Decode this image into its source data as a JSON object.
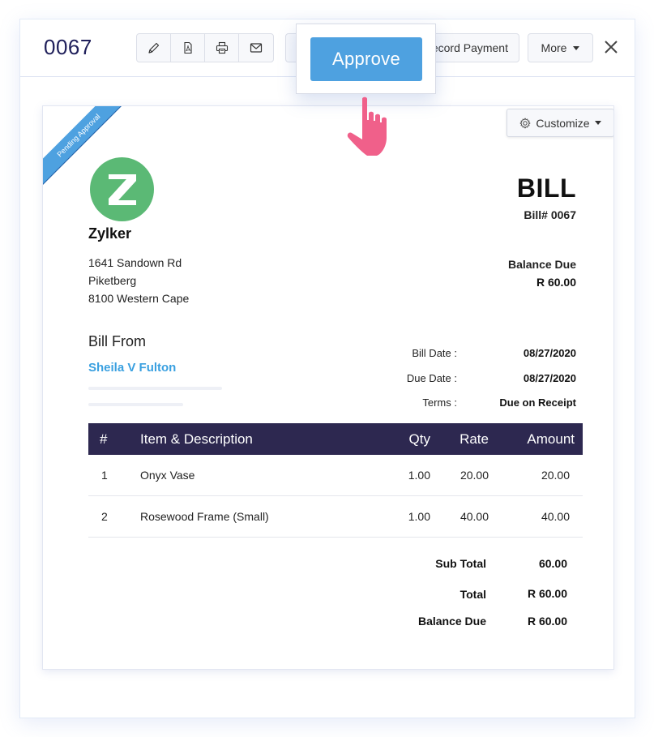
{
  "header": {
    "bill_id": "0067",
    "toolbar_icons": [
      {
        "name": "edit-icon",
        "label": "Edit"
      },
      {
        "name": "pdf-icon",
        "label": "PDF"
      },
      {
        "name": "print-icon",
        "label": "Print"
      },
      {
        "name": "mail-icon",
        "label": "Email"
      }
    ],
    "record_payment_label": "Record Payment",
    "more_label": "More",
    "close_icon": "close-icon"
  },
  "popover": {
    "approve_label": "Approve"
  },
  "document": {
    "status_ribbon": "Pending Approval",
    "customize_label": "Customize",
    "company": {
      "logo_letter": "Z",
      "name": "Zylker",
      "address": [
        "1641 Sandown Rd",
        "Piketberg",
        "8100 Western Cape"
      ]
    },
    "title": "BILL",
    "bill_number": "Bill# 0067",
    "balance_due_label": "Balance Due",
    "balance_due_value": "R 60.00",
    "bill_from_label": "Bill From",
    "vendor_name": "Sheila V Fulton",
    "meta": [
      {
        "label": "Bill Date :",
        "value": "08/27/2020"
      },
      {
        "label": "Due Date :",
        "value": "08/27/2020"
      },
      {
        "label": "Terms :",
        "value": "Due on Receipt"
      }
    ],
    "table": {
      "headers": [
        "#",
        "Item & Description",
        "Qty",
        "Rate",
        "Amount"
      ],
      "rows": [
        [
          "1",
          "Onyx Vase",
          "1.00",
          "20.00",
          "20.00"
        ],
        [
          "2",
          "Rosewood Frame (Small)",
          "1.00",
          "40.00",
          "40.00"
        ]
      ]
    },
    "totals": [
      {
        "label": "Sub Total",
        "value": "60.00"
      },
      {
        "label": "Total",
        "value": "R 60.00"
      },
      {
        "label": "Balance Due",
        "value": "R 60.00"
      }
    ]
  },
  "colors": {
    "accent": "#4ea1e0",
    "table_header": "#2d2850",
    "logo_green": "#5bb975",
    "vendor_link": "#3aa0e0",
    "pointer_hand": "#f0608a"
  }
}
